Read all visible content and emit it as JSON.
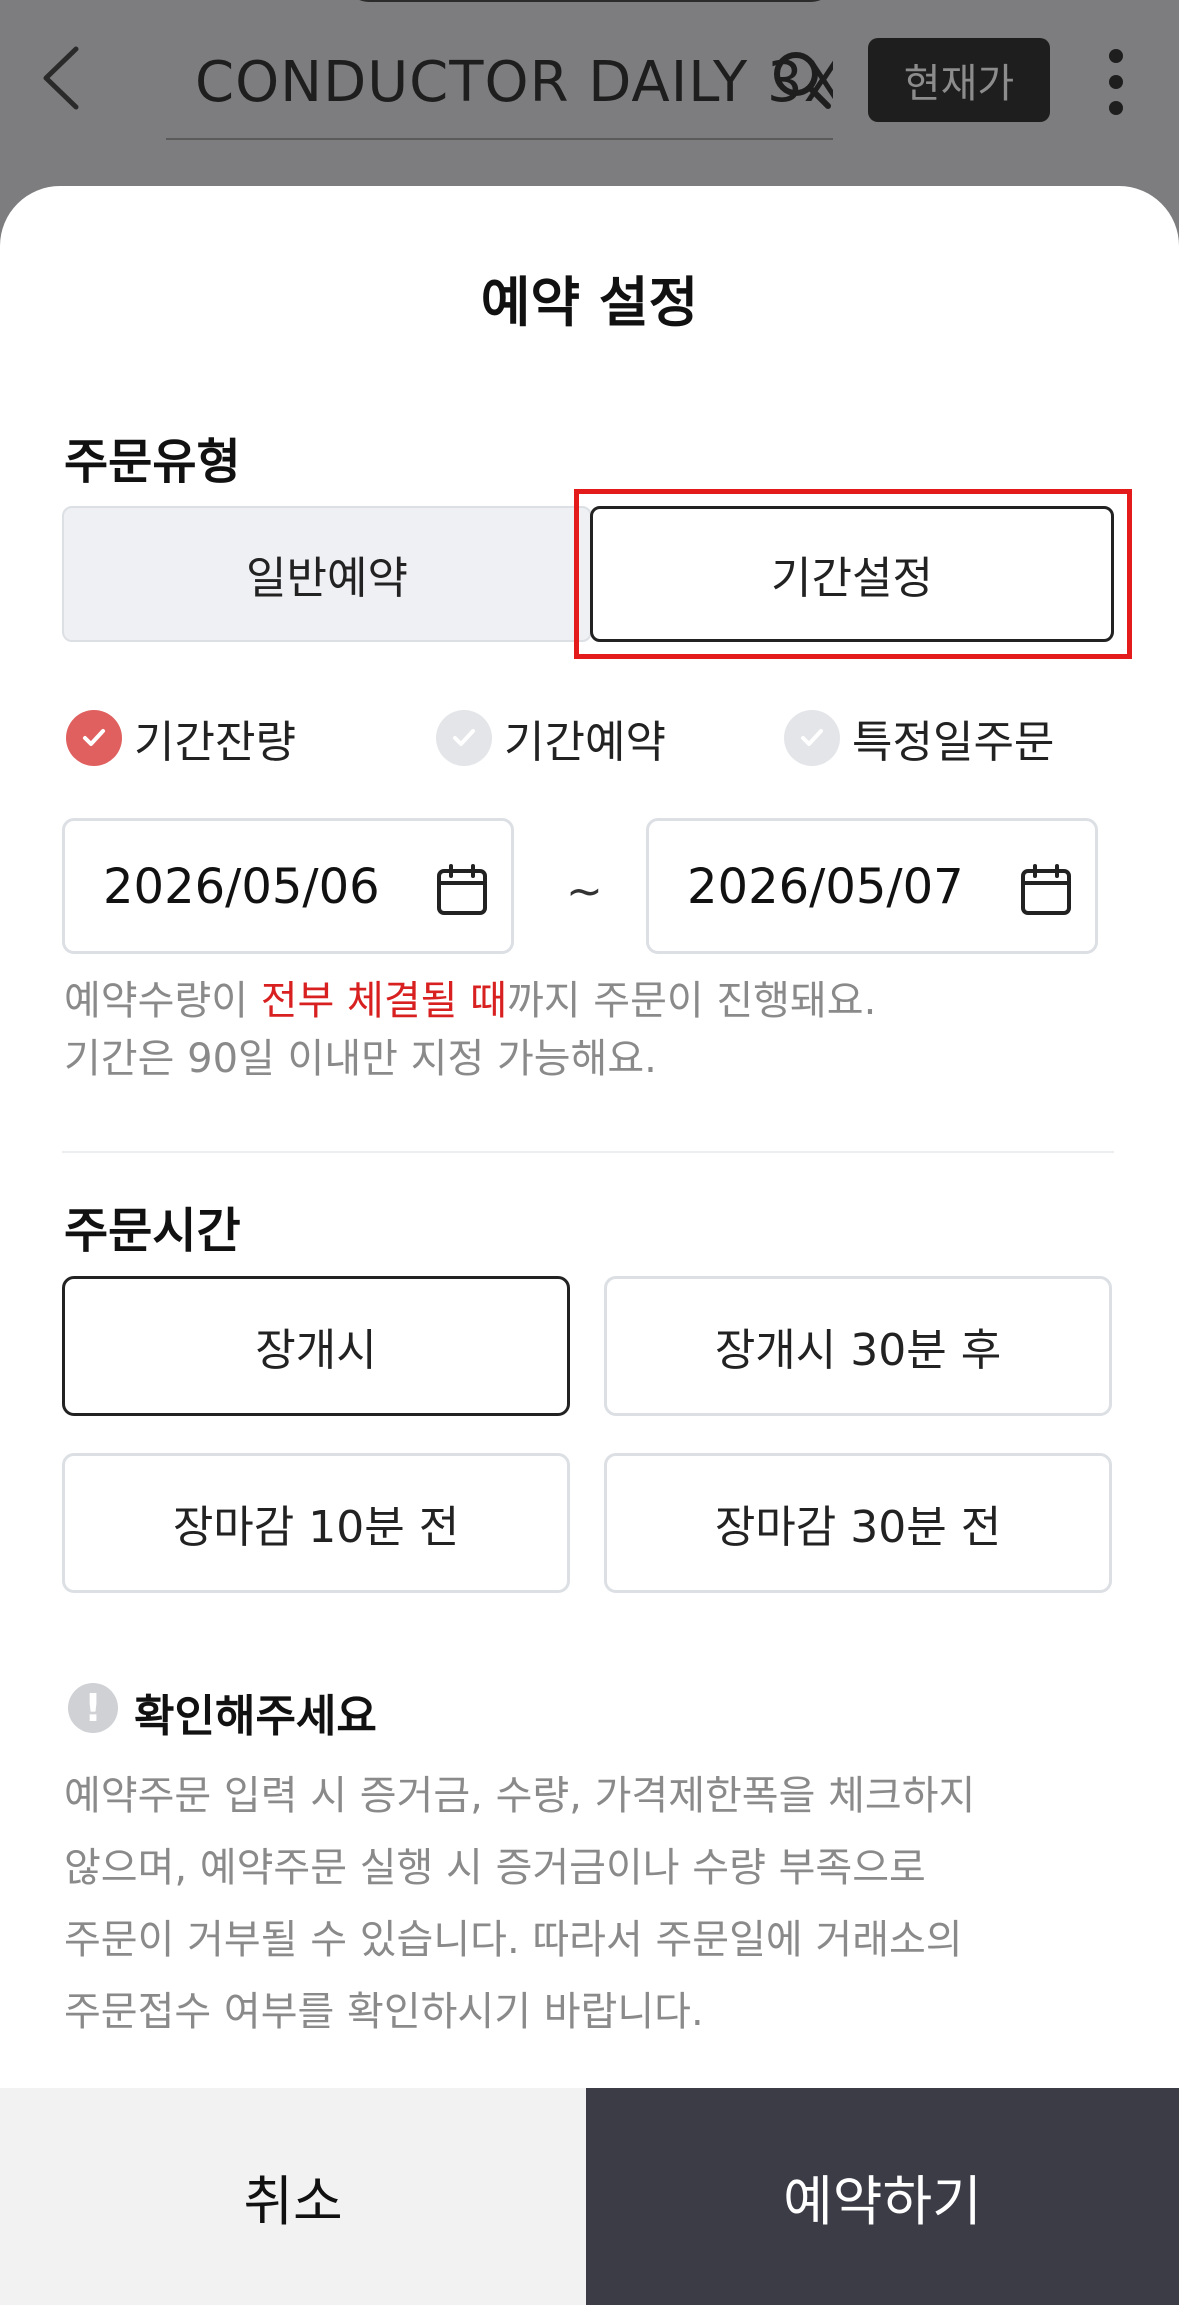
{
  "header": {
    "title": "CONDUCTOR DAILY 3X",
    "current_price_button": "현재가"
  },
  "sheet": {
    "title": "예약 설정",
    "order_type": {
      "label": "주문유형",
      "options": [
        "일반예약",
        "기간설정"
      ],
      "selected": "기간설정",
      "highlight_color": "#e31b1b"
    },
    "sub_options": [
      {
        "label": "기간잔량",
        "checked": true
      },
      {
        "label": "기간예약",
        "checked": false
      },
      {
        "label": "특정일주문",
        "checked": false
      }
    ],
    "start_date": "2026/05/06",
    "separator": "~",
    "end_date": "2026/05/07",
    "note": {
      "line1_pre": "예약수량이 ",
      "line1_red": "전부 체결될 때",
      "line1_post": "까지 주문이 진행돼요.",
      "line2": "기간은 90일 이내만 지정 가능해요."
    },
    "order_time": {
      "label": "주문시간",
      "options": [
        "장개시",
        "장개시 30분 후",
        "장마감 10분 전",
        "장마감 30분 전"
      ],
      "selected": "장개시"
    },
    "warning": {
      "icon": "!",
      "title": "확인해주세요",
      "lines": [
        "예약주문 입력 시 증거금, 수량, 가격제한폭을 체크하지",
        "않으며, 예약주문 실행 시 증거금이나 수량 부족으로",
        "주문이 거부될 수 있습니다. 따라서 주문일에 거래소의",
        "주문접수 여부를 확인하시기 바랍니다."
      ]
    }
  },
  "footer": {
    "cancel": "취소",
    "reserve": "예약하기"
  },
  "colors": {
    "accent_red": "#e06060",
    "primary_dark": "#3b3c46"
  }
}
